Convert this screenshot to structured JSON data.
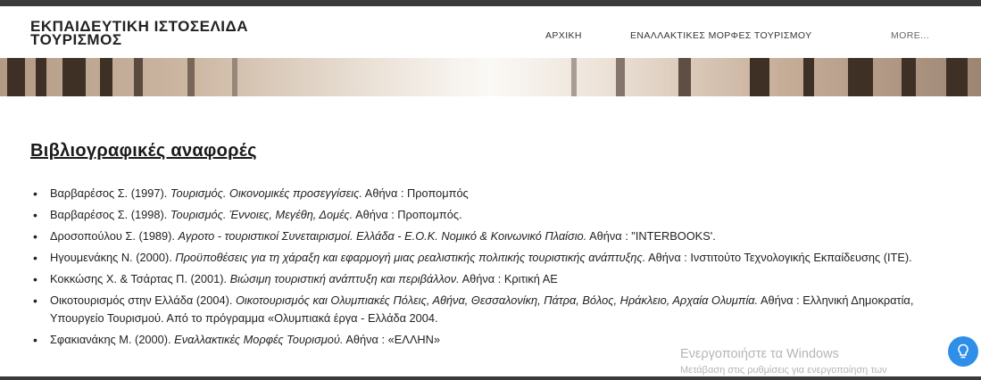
{
  "header": {
    "site_title_line1": "ΕΚΠΑΙΔΕΥΤΙΚΗ ΙΣΤΟΣΕΛΙΔΑ",
    "site_title_line2": "ΤΟΥΡΙΣΜΟΣ",
    "nav": [
      {
        "label": "ΑΡΧΙΚΗ"
      },
      {
        "label": "ΕΝΑΛΛΑΚΤΙΚΕΣ ΜΟΡΦΕΣ ΤΟΥΡΙΣΜΟΥ"
      },
      {
        "label": "MORE..."
      }
    ]
  },
  "main": {
    "heading": "Βιβλιογραφικές αναφορές",
    "references": [
      {
        "pre": "Βαρβαρέσος Σ. (1997). ",
        "title": "Τουρισμός. Οικονομικές προσεγγίσεις.",
        "post": " Αθήνα : Προπομπός"
      },
      {
        "pre": "Βαρβαρέσος Σ. (1998). ",
        "title": "Τουρισμός. Έννοιες, Μεγέθη, Δομές.",
        "post": " Αθήνα : Προπομπός."
      },
      {
        "pre": "Δροσοπούλου Σ. (1989). ",
        "title": "Αγροτο - τουριστικοί Συνεταιρισμοί. Ελλάδα - Ε.Ο.Κ. Νομικό & Κοινωνικό Πλαίσιο.",
        "post": " Αθήνα : \"INTERBOOKS'."
      },
      {
        "pre": "Ηγουμενάκης Ν. (2000). ",
        "title": "Προϋποθέσεις για τη χάραξη και εφαρμογή μιας ρεαλιστικής πολιτικής τουριστικής ανάπτυξης.",
        "post": " Αθήνα : Ινστιτούτο Τεχνολογικής Εκπαίδευσης (ΙΤΕ)."
      },
      {
        "pre": "Κοκκώσης Χ. & Τσάρτας Π. (2001). ",
        "title": "Βιώσιμη τουριστική ανάπτυξη και περιβάλλον.",
        "post": " Αθήνα : Κριτική ΑΕ"
      },
      {
        "pre": "Οικοτουρισμός στην Ελλάδα (2004). ",
        "title": "Οικοτουρισμός και Ολυμπιακές Πόλεις, Αθήνα, Θεσσαλονίκη, Πάτρα, Βόλος, Ηράκλειο, Αρχαία Ολυμπία.",
        "post": " Αθήνα : Ελληνική Δημοκρατία, Υπουργείο Τουρισμού. Από το πρόγραμμα «Ολυμπιακά έργα - Ελλάδα 2004."
      },
      {
        "pre": "Σφακιανάκης Μ. (2000). ",
        "title": "Εναλλακτικές Μορφές Τουρισμού.",
        "post": " Αθήνα : «ΕΛΛΗΝ»"
      }
    ]
  },
  "overlay": {
    "watermark_line1": "Ενεργοποιήστε τα Windows",
    "watermark_line2": "Μετάβαση στις ρυθμίσεις για ενεργοποίηση των",
    "help_icon": "lightbulb-icon"
  },
  "colors": {
    "accent": "#2f8ee8",
    "topbar": "#3b3b3b"
  }
}
